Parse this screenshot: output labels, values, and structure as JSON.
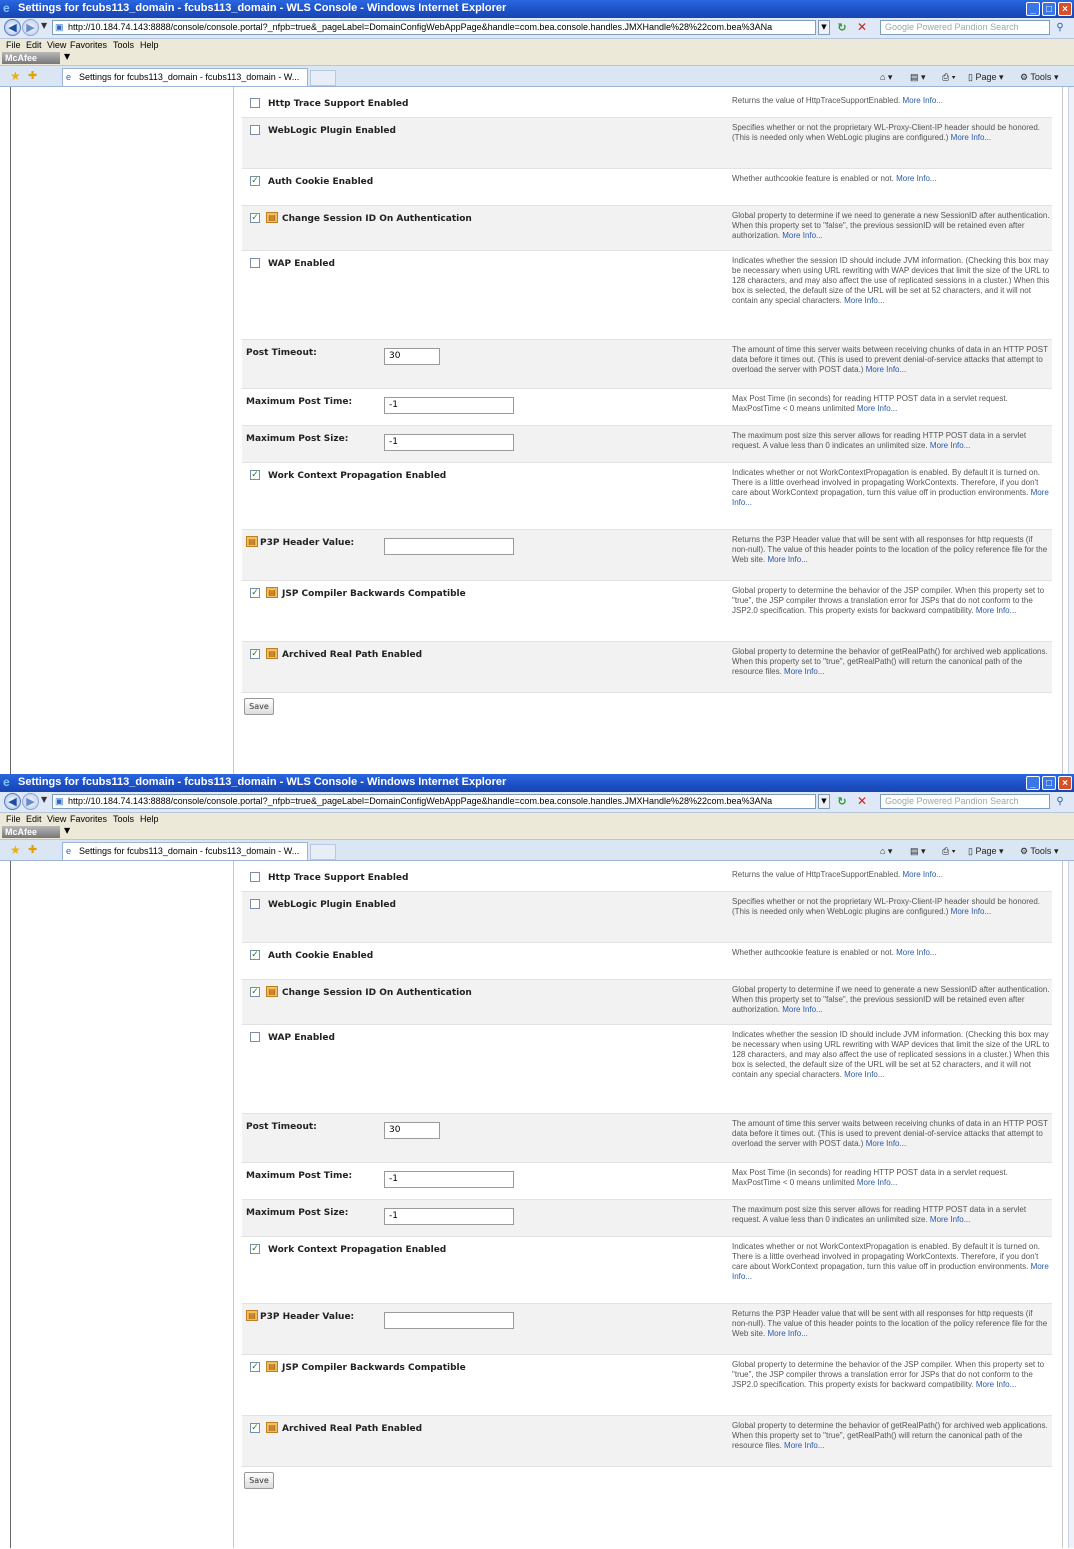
{
  "window": {
    "title": "Settings for fcubs113_domain - fcubs113_domain - WLS Console - Windows Internet Explorer",
    "url": "http://10.184.74.143:8888/console/console.portal?_nfpb=true&_pageLabel=DomainConfigWebAppPage&handle=com.bea.console.handles.JMXHandle%28%22com.bea%3ANa",
    "search_placeholder": "Google Powered Pandion Search"
  },
  "menu": [
    "File",
    "Edit",
    "View",
    "Favorites",
    "Tools",
    "Help"
  ],
  "toolbar": {
    "mcafee_label": "McAfee"
  },
  "tab": {
    "label": "Settings for fcubs113_domain - fcubs113_domain - W..."
  },
  "commands": {
    "page": "Page",
    "tools": "Tools"
  },
  "icons": [
    "ie-icon",
    "back-arrow-icon",
    "forward-arrow-icon",
    "page-icon",
    "refresh-icon",
    "stop-icon",
    "search-icon",
    "favorites-star-icon",
    "add-favorites-icon",
    "home-icon",
    "feeds-icon",
    "print-icon",
    "page-icon",
    "tools-gear-icon",
    "checkbox-icon",
    "dynamic-attribute-icon"
  ],
  "settings": [
    {
      "type": "checkbox",
      "label": "Http Trace Support Enabled",
      "checked": false,
      "dynamic": false,
      "desc": "Returns the value of HttpTraceSupportEnabled.",
      "more": "More Info..."
    },
    {
      "type": "checkbox",
      "label": "WebLogic Plugin Enabled",
      "checked": false,
      "dynamic": false,
      "desc": "Specifies whether or not the proprietary WL-Proxy-Client-IP header should be honored. (This is needed only when WebLogic plugins are configured.)",
      "more": "More Info..."
    },
    {
      "type": "checkbox",
      "label": "Auth Cookie Enabled",
      "checked": true,
      "dynamic": false,
      "desc": "Whether authcookie feature is enabled or not.",
      "more": "More Info..."
    },
    {
      "type": "checkbox",
      "label": "Change Session ID On Authentication",
      "checked": true,
      "dynamic": true,
      "desc": "Global property to determine if we need to generate a new SessionID after authentication. When this property set to \"false\", the previous sessionID will be retained even after authorization.",
      "more": "More Info..."
    },
    {
      "type": "checkbox",
      "label": "WAP Enabled",
      "checked": false,
      "dynamic": false,
      "desc": "Indicates whether the session ID should include JVM information. (Checking this box may be necessary when using URL rewriting with WAP devices that limit the size of the URL to 128 characters, and may also affect the use of replicated sessions in a cluster.) When this box is selected, the default size of the URL will be set at 52 characters, and it will not contain any special characters.",
      "more": "More Info..."
    },
    {
      "type": "text",
      "label": "Post Timeout:",
      "value": "30",
      "dynamic": false,
      "desc": "The amount of time this server waits between receiving chunks of data in an HTTP POST data before it times out. (This is used to prevent denial-of-service attacks that attempt to overload the server with POST data.)",
      "more": "More Info..."
    },
    {
      "type": "text",
      "label": "Maximum Post Time:",
      "value": "-1",
      "dynamic": false,
      "desc": "Max Post Time (in seconds) for reading HTTP POST data in a servlet request. MaxPostTime < 0 means unlimited",
      "more": "More Info..."
    },
    {
      "type": "text",
      "label": "Maximum Post Size:",
      "value": "-1",
      "dynamic": false,
      "desc": "The maximum post size this server allows for reading HTTP POST data in a servlet request. A value less than 0 indicates an unlimited size.",
      "more": "More Info..."
    },
    {
      "type": "checkbox",
      "label": "Work Context Propagation Enabled",
      "checked": true,
      "dynamic": false,
      "desc": "Indicates whether or not WorkContextPropagation is enabled. By default it is turned on. There is a little overhead involved in propagating WorkContexts. Therefore, if you don't care about WorkContext propagation, turn this value off in production environments.",
      "more": "More Info..."
    },
    {
      "type": "text",
      "label": "P3P Header Value:",
      "value": "",
      "dynamic": true,
      "desc": "Returns the P3P Header value that will be sent with all responses for http requests (if non-null). The value of this header points to the location of the policy reference file for the Web site.",
      "more": "More Info..."
    },
    {
      "type": "checkbox",
      "label": "JSP Compiler Backwards Compatible",
      "checked": true,
      "dynamic": true,
      "desc": "Global property to determine the behavior of the JSP compiler. When this property set to \"true\", the JSP compiler throws a translation error for JSPs that do not conform to the JSP2.0 specification. This property exists for backward compatibility.",
      "more": "More Info..."
    },
    {
      "type": "checkbox",
      "label": "Archived Real Path Enabled",
      "checked": true,
      "dynamic": true,
      "desc": "Global property to determine the behavior of getRealPath() for archived web applications. When this property set to \"true\", getRealPath() will return the canonical path of the resource files.",
      "more": "More Info..."
    }
  ],
  "save_label": "Save"
}
